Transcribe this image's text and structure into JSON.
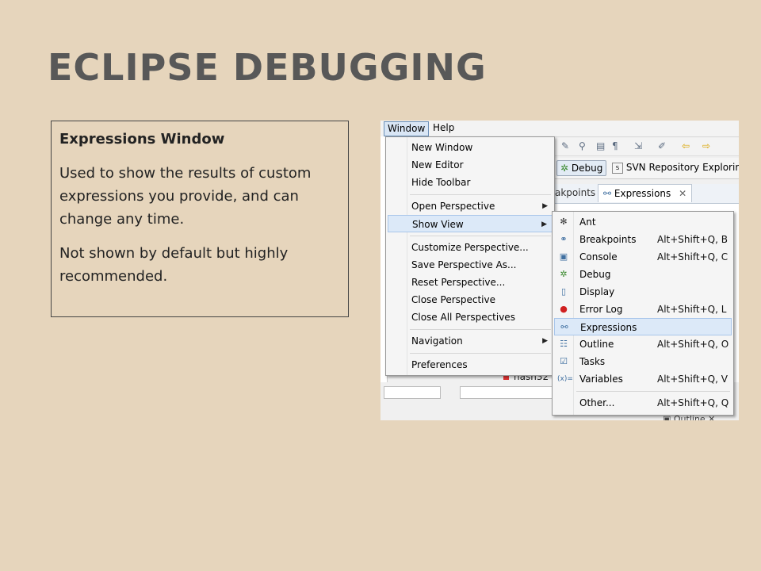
{
  "slide": {
    "title": "ECLIPSE DEBUGGING",
    "box_heading": "Expressions Window",
    "box_para1": "Used to show the results of custom expressions you provide, and can change any time.",
    "box_para2": "Not shown by default but highly recommended."
  },
  "menubar": {
    "window": "Window",
    "help": "Help"
  },
  "perspectives": {
    "debug": "Debug",
    "svn": "SVN Repository Exploring"
  },
  "tabs": {
    "breakpoints": "akpoints",
    "expressions": "Expressions"
  },
  "background": {
    "hash_label": "hash32",
    "outline_label": "Outline"
  },
  "window_menu": {
    "items": [
      {
        "label": "New Window"
      },
      {
        "label": "New Editor"
      },
      {
        "label": "Hide Toolbar"
      },
      {
        "label": "Open Perspective"
      },
      {
        "label": "Show View"
      },
      {
        "label": "Customize Perspective..."
      },
      {
        "label": "Save Perspective As..."
      },
      {
        "label": "Reset Perspective..."
      },
      {
        "label": "Close Perspective"
      },
      {
        "label": "Close All Perspectives"
      },
      {
        "label": "Navigation"
      },
      {
        "label": "Preferences"
      }
    ]
  },
  "show_view_menu": {
    "items": [
      {
        "label": "Ant",
        "shortcut": ""
      },
      {
        "label": "Breakpoints",
        "shortcut": "Alt+Shift+Q, B"
      },
      {
        "label": "Console",
        "shortcut": "Alt+Shift+Q, C"
      },
      {
        "label": "Debug",
        "shortcut": ""
      },
      {
        "label": "Display",
        "shortcut": ""
      },
      {
        "label": "Error Log",
        "shortcut": "Alt+Shift+Q, L"
      },
      {
        "label": "Expressions",
        "shortcut": ""
      },
      {
        "label": "Outline",
        "shortcut": "Alt+Shift+Q, O"
      },
      {
        "label": "Tasks",
        "shortcut": ""
      },
      {
        "label": "Variables",
        "shortcut": "Alt+Shift+Q, V"
      },
      {
        "label": "Other...",
        "shortcut": "Alt+Shift+Q, Q"
      }
    ]
  },
  "colors": {
    "slide_bg": "#e6d5bc",
    "title": "#585858",
    "menu_highlight": "#dce9f8"
  }
}
